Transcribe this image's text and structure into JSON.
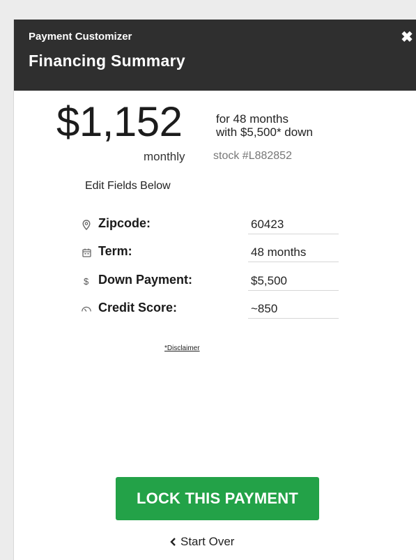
{
  "header": {
    "subtitle": "Payment Customizer",
    "title": "Financing Summary",
    "close_glyph": "✖",
    "close_icon": "close-icon"
  },
  "summary": {
    "price": "$1,152",
    "period": "monthly",
    "term_line": "for 48 months",
    "down_line": "with $5,500* down",
    "stock": "stock #L882852"
  },
  "edit_label": "Edit Fields Below",
  "fields": [
    {
      "icon": "location-pin-icon",
      "label": "Zipcode:",
      "value": "60423"
    },
    {
      "icon": "calendar-icon",
      "label": "Term:",
      "value": "48 months"
    },
    {
      "icon": "dollar-icon",
      "label": "Down Payment:",
      "value": "$5,500"
    },
    {
      "icon": "gauge-icon",
      "label": "Credit Score:",
      "value": "~850"
    }
  ],
  "disclaimer": "*Disclaimer",
  "lock_button": "LOCK THIS PAYMENT",
  "start_over": "Start Over",
  "colors": {
    "header_bg": "#2f2f2f",
    "accent_green": "#23a248"
  }
}
